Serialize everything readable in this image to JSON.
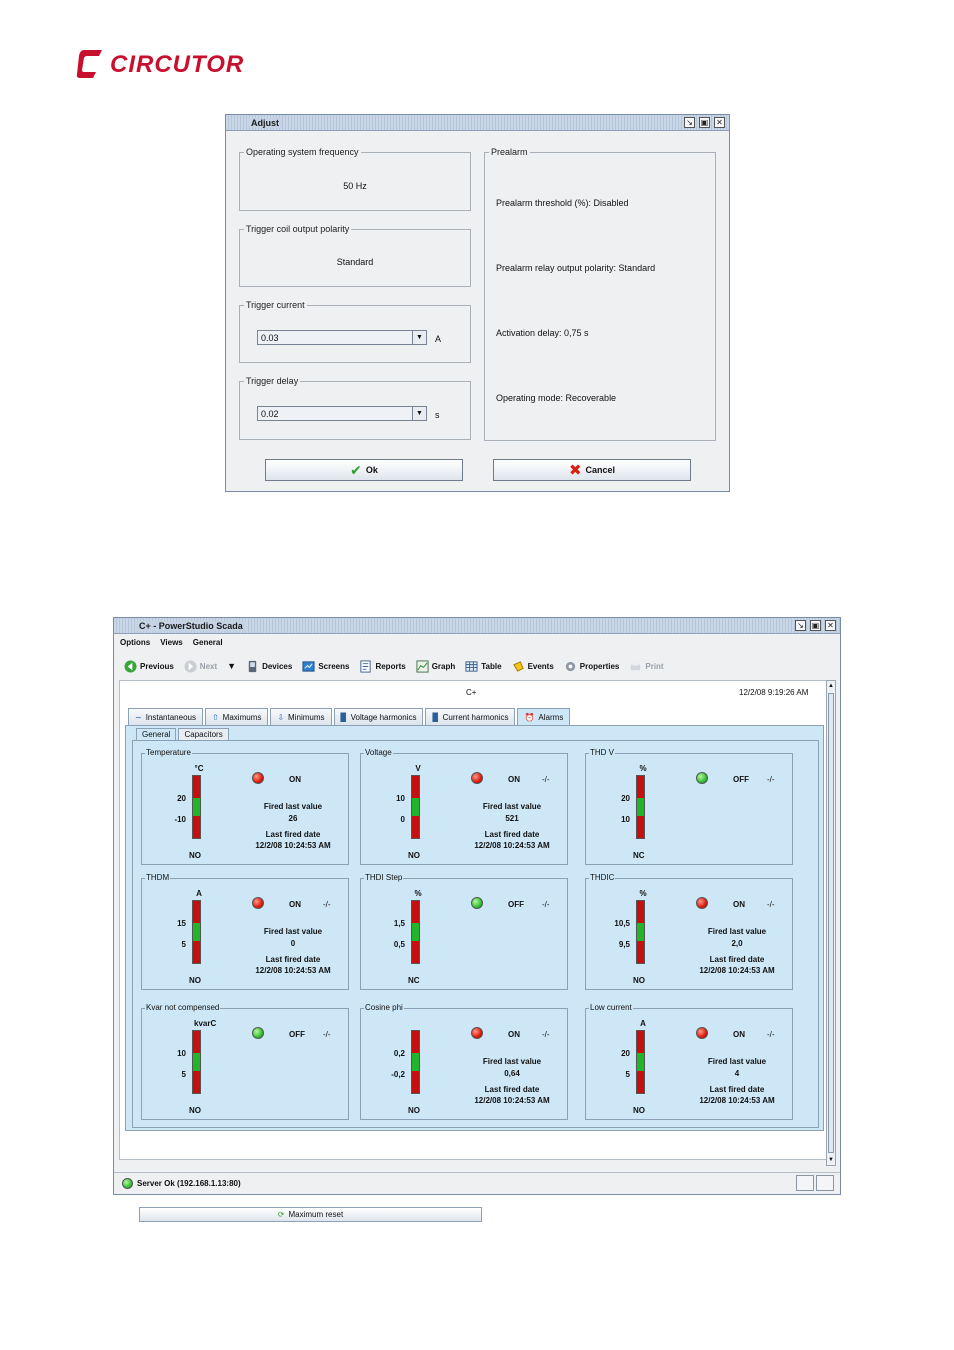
{
  "logo": {
    "text": "CIRCUTOR",
    "color": "#c8102e"
  },
  "adjust": {
    "title": "Adjust",
    "freq_label": "Operating system frequency",
    "freq_value": "50 Hz",
    "polarity_label": "Trigger coil output polarity",
    "polarity_value": "Standard",
    "current_label": "Trigger current",
    "current_value": "0.03",
    "current_unit": "A",
    "delay_label": "Trigger delay",
    "delay_value": "0.02",
    "delay_unit": "s",
    "prealarm_label": "Prealarm",
    "prealarm_lines": [
      "Prealarm threshold (%): Disabled",
      "Prealarm relay output polarity: Standard",
      "Activation delay: 0,75 s",
      "Operating mode: Recoverable"
    ],
    "ok_label": "Ok",
    "cancel_label": "Cancel"
  },
  "scada": {
    "title": "C+ - PowerStudio Scada",
    "menu": [
      "Options",
      "Views",
      "General"
    ],
    "toolbar": {
      "previous": "Previous",
      "next": "Next",
      "devices": "Devices",
      "screens": "Screens",
      "reports": "Reports",
      "graph": "Graph",
      "table": "Table",
      "events": "Events",
      "properties": "Properties",
      "print": "Print"
    },
    "center_label": "C+",
    "datetime": "12/2/08 9:19:26 AM",
    "tabs": [
      "Instantaneous",
      "Maximums",
      "Minimums",
      "Voltage harmonics",
      "Current harmonics",
      "Alarms"
    ],
    "subtabs": [
      "General",
      "Capacitors"
    ],
    "alarms": [
      {
        "title": "Temperature",
        "unit": "°C",
        "hi": "20",
        "lo": "-10",
        "nono": "NO",
        "led": "red",
        "state": "ON",
        "sw": "",
        "fired_label": "Fired last value",
        "fired_value": "26",
        "date_label": "Last fired date",
        "date_value": "12/2/08 10:24:53 AM"
      },
      {
        "title": "Voltage",
        "unit": "V",
        "hi": "10",
        "lo": "0",
        "nono": "NO",
        "led": "red",
        "state": "ON",
        "sw": "-/-",
        "fired_label": "Fired last value",
        "fired_value": "521",
        "date_label": "Last fired date",
        "date_value": "12/2/08 10:24:53 AM"
      },
      {
        "title": "THD V",
        "unit": "%",
        "hi": "20",
        "lo": "10",
        "nono": "NC",
        "led": "green",
        "state": "OFF",
        "sw": "-/-",
        "fired_label": "",
        "fired_value": "",
        "date_label": "",
        "date_value": ""
      },
      {
        "title": "THDM",
        "unit": "A",
        "hi": "15",
        "lo": "5",
        "nono": "NO",
        "led": "red",
        "state": "ON",
        "sw": "-/-",
        "fired_label": "Fired last value",
        "fired_value": "0",
        "date_label": "Last fired date",
        "date_value": "12/2/08 10:24:53 AM"
      },
      {
        "title": "THDI Step",
        "unit": "%",
        "hi": "1,5",
        "lo": "0,5",
        "nono": "NC",
        "led": "green",
        "state": "OFF",
        "sw": "-/-",
        "fired_label": "",
        "fired_value": "",
        "date_label": "",
        "date_value": ""
      },
      {
        "title": "THDIC",
        "unit": "%",
        "hi": "10,5",
        "lo": "9,5",
        "nono": "NO",
        "led": "red",
        "state": "ON",
        "sw": "-/-",
        "fired_label": "Fired last value",
        "fired_value": "2,0",
        "date_label": "Last fired date",
        "date_value": "12/2/08 10:24:53 AM"
      },
      {
        "title": "Kvar not compensed",
        "unit": "kvarC",
        "hi": "10",
        "lo": "5",
        "nono": "NO",
        "led": "green",
        "state": "OFF",
        "sw": "-/-",
        "fired_label": "",
        "fired_value": "",
        "date_label": "",
        "date_value": ""
      },
      {
        "title": "Cosine phi",
        "unit": "",
        "hi": "0,2",
        "lo": "-0,2",
        "nono": "NO",
        "led": "red",
        "state": "ON",
        "sw": "-/-",
        "fired_label": "Fired last value",
        "fired_value": "0,64",
        "date_label": "Last fired date",
        "date_value": "12/2/08 10:24:53 AM"
      },
      {
        "title": "Low current",
        "unit": "A",
        "hi": "20",
        "lo": "5",
        "nono": "NO",
        "led": "red",
        "state": "ON",
        "sw": "-/-",
        "fired_label": "Fired last value",
        "fired_value": "4",
        "date_label": "Last fired date",
        "date_value": "12/2/08 10:24:53 AM"
      }
    ],
    "reset_label": "Maximum reset",
    "status": "Server Ok (192.168.1.13:80)"
  }
}
